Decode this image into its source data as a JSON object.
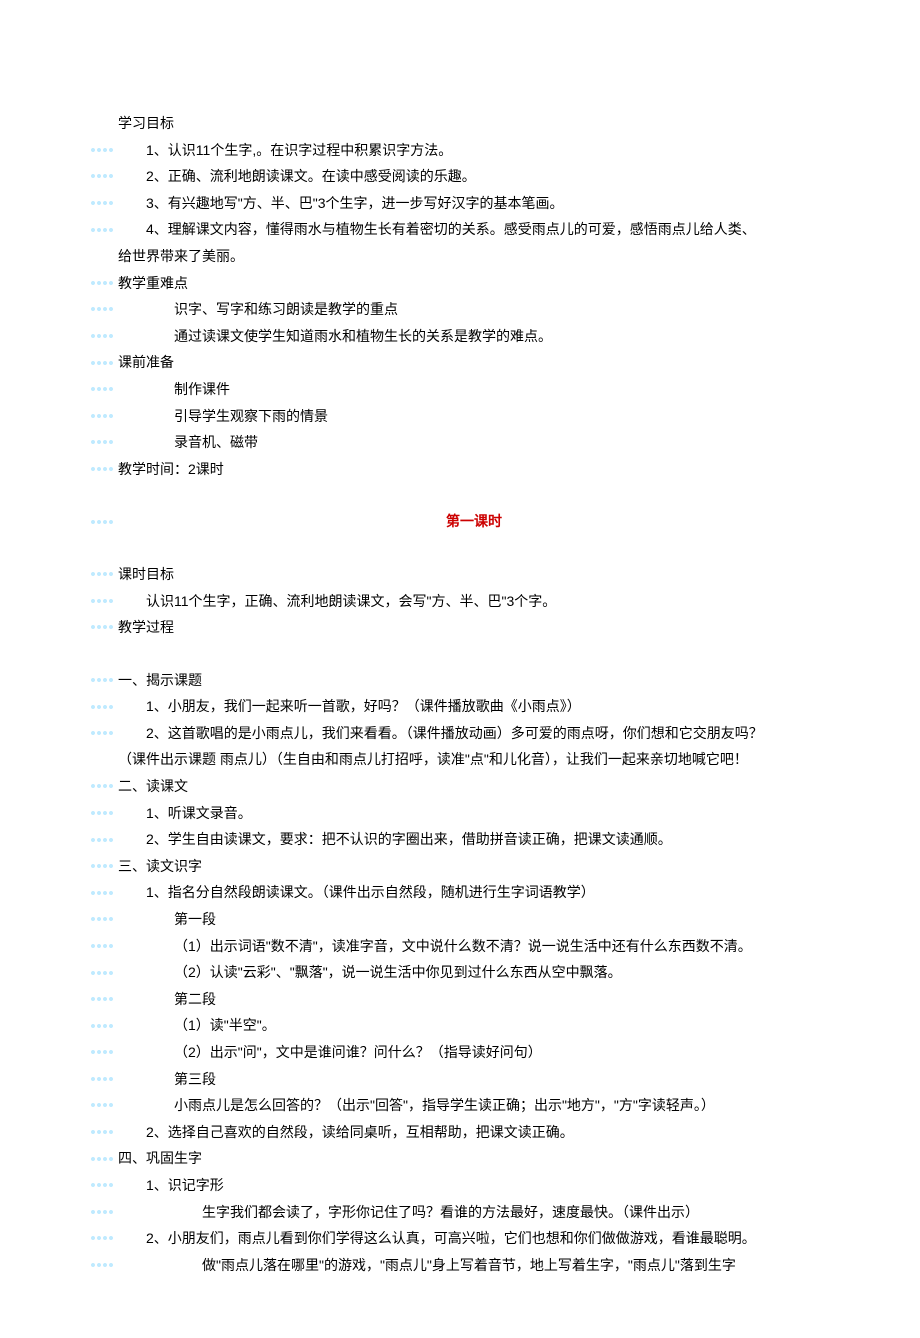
{
  "section_header": "学习目标",
  "goals": [
    "1、认识11个生字,。在识字过程中积累识字方法。",
    "2、正确、流利地朗读课文。在读中感受阅读的乐趣。",
    "3、有兴趣地写\"方、半、巴\"3个生字，进一步写好汉字的基本笔画。",
    "4、理解课文内容，懂得雨水与植物生长有着密切的关系。感受雨点儿的可爱，感悟雨点儿给人类、"
  ],
  "goals_cont": "给世界带来了美丽。",
  "headings": {
    "zhongdian": "教学重难点",
    "zhongdian_items": [
      "识字、写字和练习朗读是教学的重点",
      "通过读课文使学生知道雨水和植物生长的关系是教学的难点。"
    ],
    "keqian": "课前准备",
    "keqian_items": [
      "制作课件",
      "引导学生观察下雨的情景",
      "录音机、磁带"
    ],
    "time": "教学时间：2课时"
  },
  "period1_title": "第一课时",
  "keshi_mubiao_label": "课时目标",
  "keshi_mubiao": "认识11个生字，正确、流利地朗读课文，会写\"方、半、巴\"3个字。",
  "guocheng_label": "教学过程",
  "s1": {
    "title": "一、揭示课题",
    "p1": "1、小朋友，我们一起来听一首歌，好吗？（课件播放歌曲《小雨点》）",
    "p2": "2、这首歌唱的是小雨点儿，我们来看看。（课件播放动画）多可爱的雨点呀，你们想和它交朋友吗？",
    "p2b": "（课件出示课题 雨点儿）（生自由和雨点儿打招呼，读准\"点\"和儿化音），让我们一起来亲切地喊它吧！"
  },
  "s2": {
    "title": "二、读课文",
    "p1": "1、听课文录音。",
    "p2": "2、学生自由读课文，要求：把不认识的字圈出来，借助拼音读正确，把课文读通顺。"
  },
  "s3": {
    "title": "三、读文识字",
    "p1": "1、指名分自然段朗读课文。（课件出示自然段，随机进行生字词语教学）",
    "d1_label": "第一段",
    "d1a": "（1）出示词语\"数不清\"，读准字音，文中说什么数不清？说一说生活中还有什么东西数不清。",
    "d1b": "（2）认读\"云彩\"、\"飘落\"，说一说生活中你见到过什么东西从空中飘落。",
    "d2_label": "第二段",
    "d2a": "（1）读\"半空\"。",
    "d2b": "（2）出示\"问\"，文中是谁问谁？问什么？（指导读好问句）",
    "d3_label": "第三段",
    "d3a": "小雨点儿是怎么回答的？（出示\"回答\"，指导学生读正确；出示\"地方\"，\"方\"字读轻声。）",
    "p2": "2、选择自己喜欢的自然段，读给同桌听，互相帮助，把课文读正确。"
  },
  "s4": {
    "title": "四、巩固生字",
    "p1": "1、识记字形",
    "p1a": "生字我们都会读了，字形你记住了吗？看谁的方法最好，速度最快。（课件出示）",
    "p2": "2、小朋友们，雨点儿看到你们学得这么认真，可高兴啦，它们也想和你们做做游戏，看谁最聪明。",
    "p2a": "做\"雨点儿落在哪里\"的游戏，\"雨点儿\"身上写着音节，地上写着生字，\"雨点儿\"落到生字"
  }
}
